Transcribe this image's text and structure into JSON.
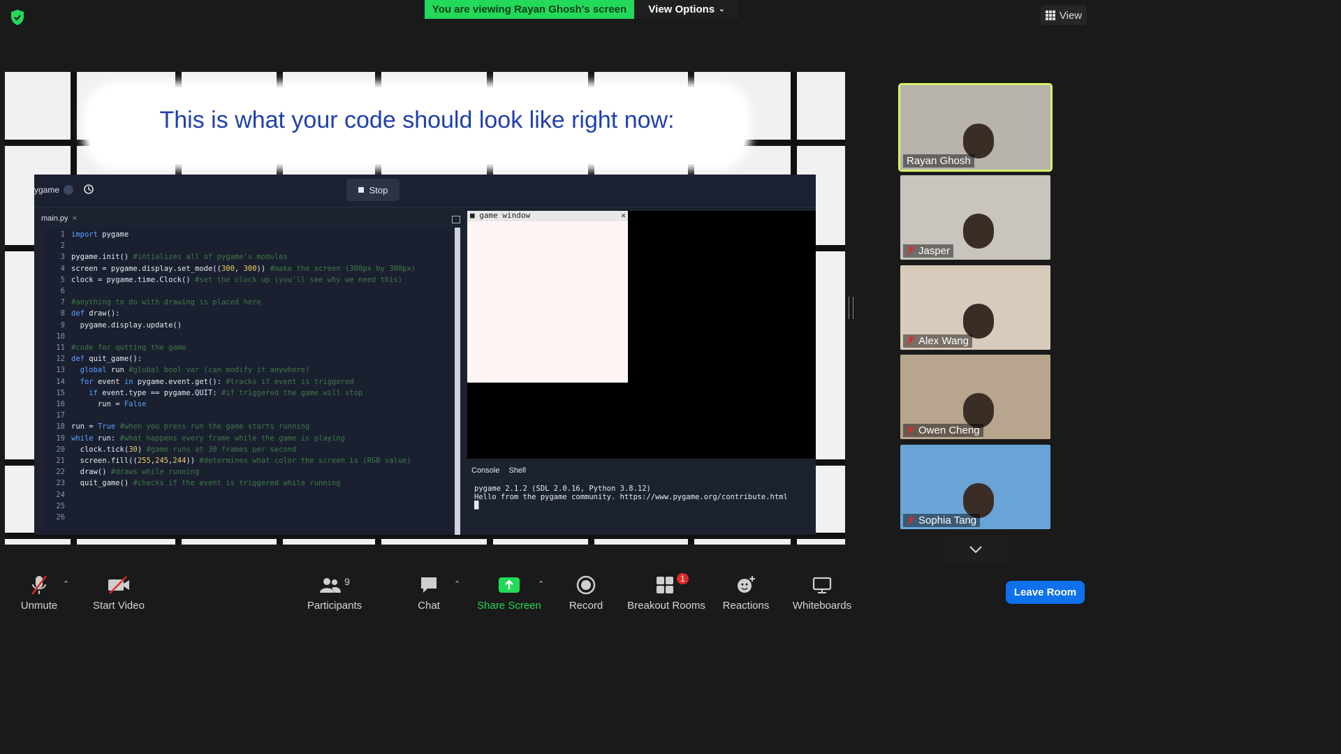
{
  "banner": {
    "viewing": "You are viewing Rayan Ghosh's screen",
    "view_options": "View Options"
  },
  "view_button": "View",
  "slide": {
    "headline": "This is what your code should look like right now:"
  },
  "ide": {
    "project": "ygame",
    "stop": "Stop",
    "tab": "main.py",
    "tab_close": "×",
    "lines": [
      {
        "n": "1",
        "t": "import pygame"
      },
      {
        "n": "2",
        "t": ""
      },
      {
        "n": "3",
        "t": "pygame.init() #intializes all of pygame's modules"
      },
      {
        "n": "4",
        "t": "screen = pygame.display.set_mode((300, 300)) #make the screen (300px by 300px)"
      },
      {
        "n": "5",
        "t": "clock = pygame.time.Clock() #set the clock up (you'll see why we need this)"
      },
      {
        "n": "6",
        "t": ""
      },
      {
        "n": "7",
        "t": "#anything to do with drawing is placed here"
      },
      {
        "n": "8",
        "t": "def draw():"
      },
      {
        "n": "9",
        "t": "  pygame.display.update()"
      },
      {
        "n": "10",
        "t": ""
      },
      {
        "n": "11",
        "t": "#code for qutting the game"
      },
      {
        "n": "12",
        "t": "def quit_game():"
      },
      {
        "n": "13",
        "t": "  global run #global bool var (can modify it anywhere)"
      },
      {
        "n": "14",
        "t": "  for event in pygame.event.get(): #tracks if event is triggered"
      },
      {
        "n": "15",
        "t": "    if event.type == pygame.QUIT: #if triggered the game will stop"
      },
      {
        "n": "16",
        "t": "      run = False"
      },
      {
        "n": "17",
        "t": ""
      },
      {
        "n": "18",
        "t": "run = True #when you press run the game starts running"
      },
      {
        "n": "19",
        "t": "while run: #what happens every frame while the game is playing"
      },
      {
        "n": "20",
        "t": "  clock.tick(30) #game runs at 30 frames per second"
      },
      {
        "n": "21",
        "t": "  screen.fill((255,245,244)) #determines what color the screen is (RGB value)"
      },
      {
        "n": "22",
        "t": "  draw() #draws while running"
      },
      {
        "n": "23",
        "t": "  quit_game() #checks if the event is triggered while running"
      },
      {
        "n": "24",
        "t": ""
      },
      {
        "n": "25",
        "t": ""
      },
      {
        "n": "26",
        "t": ""
      }
    ],
    "game_window_title": "game window",
    "console_tab": "Console",
    "shell_tab": "Shell",
    "console_output": "pygame 2.1.2 (SDL 2.0.16, Python 3.8.12)\nHello from the pygame community. https://www.pygame.org/contribute.html\n█"
  },
  "participants": [
    {
      "name": "Rayan Ghosh",
      "muted": false,
      "active": true,
      "bg": "#b9b3ad"
    },
    {
      "name": "Jasper",
      "muted": true,
      "active": false,
      "bg": "#c9c4bd"
    },
    {
      "name": "Alex Wang",
      "muted": true,
      "active": false,
      "bg": "#d9cbbb"
    },
    {
      "name": "Owen Cheng",
      "muted": true,
      "active": false,
      "bg": "#b7a58e"
    },
    {
      "name": "Sophia Tang",
      "muted": true,
      "active": false,
      "bg": "#6aa4d6"
    }
  ],
  "toolbar": {
    "unmute": "Unmute",
    "start_video": "Start Video",
    "participants": "Participants",
    "participants_count": "9",
    "chat": "Chat",
    "share_screen": "Share Screen",
    "record": "Record",
    "breakout_rooms": "Breakout Rooms",
    "breakout_badge": "1",
    "reactions": "Reactions",
    "whiteboards": "Whiteboards",
    "leave": "Leave Room"
  },
  "colors": {
    "share_green": "#23d959",
    "leave_blue": "#0e71eb",
    "active_border": "#d6f26a",
    "muted_red": "#e02828"
  }
}
